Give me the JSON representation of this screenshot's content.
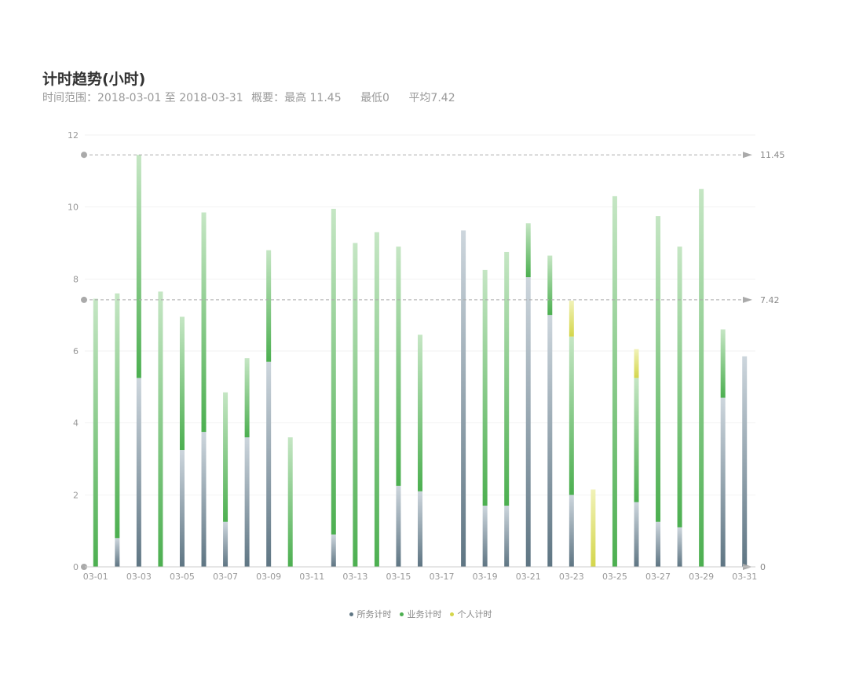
{
  "title": "计时趋势(小时)",
  "subtitle": {
    "range_label": "时间范围：2018-03-01 至 2018-03-31",
    "summary_label": "概要：最高 11.45",
    "min_label": "最低0",
    "avg_label": "平均7.42"
  },
  "colors": {
    "series1": "#5e7583",
    "series2": "#4caf50",
    "series3": "#d4d64b",
    "grid": "#f2f2f2",
    "axis_text": "#999999",
    "markline": "#aaaaaa"
  },
  "chart_data": {
    "type": "bar",
    "stacked": true,
    "categories": [
      "03-01",
      "03-02",
      "03-03",
      "03-04",
      "03-05",
      "03-06",
      "03-07",
      "03-08",
      "03-09",
      "03-10",
      "03-11",
      "03-12",
      "03-13",
      "03-14",
      "03-15",
      "03-16",
      "03-17",
      "03-18",
      "03-19",
      "03-20",
      "03-21",
      "03-22",
      "03-23",
      "03-24",
      "03-25",
      "03-26",
      "03-27",
      "03-28",
      "03-29",
      "03-30",
      "03-31"
    ],
    "x_tick_labels": [
      "03-01",
      "03-03",
      "03-05",
      "03-07",
      "03-09",
      "03-11",
      "03-13",
      "03-15",
      "03-17",
      "03-19",
      "03-21",
      "03-23",
      "03-25",
      "03-27",
      "03-29",
      "03-31"
    ],
    "series": [
      {
        "name": "所务计时",
        "values": [
          0,
          0.8,
          5.25,
          0,
          3.25,
          3.75,
          1.25,
          3.6,
          5.7,
          0,
          0,
          0.9,
          0,
          0,
          2.25,
          2.1,
          0,
          9.35,
          1.7,
          1.7,
          8.05,
          7.0,
          2.0,
          0,
          0,
          1.8,
          1.25,
          1.1,
          0,
          4.7,
          5.85
        ]
      },
      {
        "name": "业务计时",
        "values": [
          7.45,
          6.8,
          6.2,
          7.65,
          3.7,
          6.1,
          3.6,
          2.2,
          3.1,
          3.6,
          0,
          9.05,
          9.0,
          9.3,
          6.65,
          4.35,
          0,
          0,
          6.55,
          7.05,
          1.5,
          1.65,
          4.4,
          0,
          10.3,
          3.45,
          8.5,
          7.8,
          10.5,
          1.9,
          0
        ]
      },
      {
        "name": "个人计时",
        "values": [
          0,
          0,
          0,
          0,
          0,
          0,
          0,
          0,
          0,
          0,
          0,
          0,
          0,
          0,
          0,
          0,
          0,
          0,
          0,
          0,
          0,
          0,
          1.0,
          2.15,
          0,
          0.8,
          0,
          0,
          0,
          0,
          0
        ]
      }
    ],
    "ylim": [
      0,
      12
    ],
    "y_ticks": [
      0,
      2,
      4,
      6,
      8,
      10,
      12
    ],
    "mark_lines": [
      {
        "value": 11.45,
        "label": "11.45"
      },
      {
        "value": 7.42,
        "label": "7.42"
      },
      {
        "value": 0,
        "label": "0"
      }
    ],
    "grid": true,
    "legend": "bottom-center"
  }
}
